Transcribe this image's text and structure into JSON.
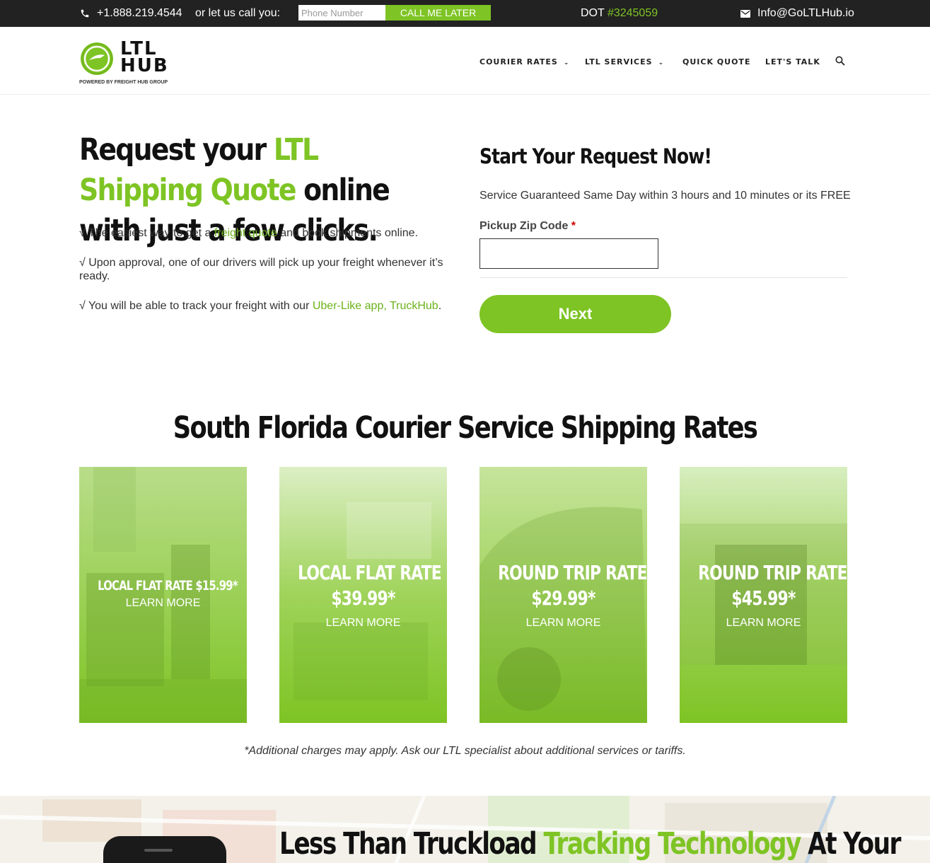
{
  "topbar": {
    "phone": "+1.888.219.4544",
    "callme_text": "or let us call you:",
    "phone_placeholder": "Phone Number",
    "call_button": "CALL ME LATER",
    "dot_label": "DOT ",
    "dot_number": "#3245059",
    "email": "Info@GoLTLHub.io"
  },
  "header": {
    "logo_line1": "LTL",
    "logo_line2": "HUB",
    "logo_sub": "POWERED BY FREIGHT HUB GROUP",
    "nav": [
      {
        "label": "COURIER RATES",
        "has_dropdown": true
      },
      {
        "label": "LTL SERVICES",
        "has_dropdown": true
      },
      {
        "label": "QUICK QUOTE",
        "has_dropdown": false
      },
      {
        "label": "LET'S TALK",
        "has_dropdown": false
      }
    ]
  },
  "hero": {
    "title_part1": "Request your ",
    "title_highlight": "LTL Shipping Quote",
    "title_part2": " online with just a few clicks.",
    "bullet1_pre": "√ The easiest way to get a ",
    "bullet1_link": "freight quote",
    "bullet1_post": " and book shipments online.",
    "bullet2": "√ Upon approval, one of our drivers will pick up your freight whenever it’s ready.",
    "bullet3_pre": "√ You will be able to track your freight with our ",
    "bullet3_link": "Uber-Like app, TruckHub",
    "bullet3_post": "."
  },
  "form": {
    "title": "Start Your Request Now!",
    "subtitle": "Service Guaranteed Same Day within 3 hours and 10 minutes or its FREE",
    "zip_label": "Pickup Zip Code",
    "required_mark": "*",
    "zip_value": "",
    "next_button": "Next"
  },
  "rates": {
    "title": "South Florida Courier Service Shipping Rates",
    "cards": [
      {
        "title": "LOCAL FLAT RATE $15.99*",
        "price": "",
        "link": "LEARN MORE"
      },
      {
        "title": "LOCAL FLAT RATE",
        "price": "$39.99*",
        "link": "LEARN MORE"
      },
      {
        "title": "ROUND TRIP RATE",
        "price": "$29.99*",
        "link": "LEARN MORE"
      },
      {
        "title": "ROUND TRIP RATE",
        "price": "$45.99*",
        "link": "LEARN MORE"
      }
    ],
    "disclaimer": "*Additional charges may apply. Ask our LTL specialist about additional services or tariffs."
  },
  "tracking": {
    "title_part1": "Less Than Truckload ",
    "title_highlight": "Tracking Technology",
    "title_part2": " At Your"
  },
  "colors": {
    "accent": "#7ec424",
    "topbar_bg": "#222222",
    "text_dark": "#111111"
  }
}
